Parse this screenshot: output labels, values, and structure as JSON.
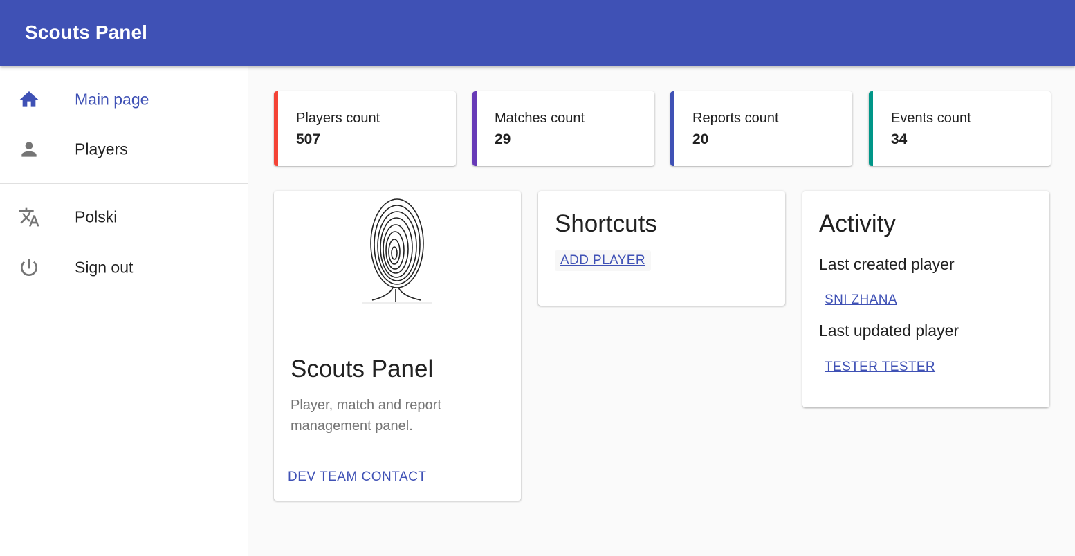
{
  "appbar": {
    "title": "Scouts Panel",
    "color": "#3f51b5"
  },
  "sidebar": {
    "items": [
      {
        "label": "Main page",
        "icon": "home-icon",
        "active": true
      },
      {
        "label": "Players",
        "icon": "person-icon",
        "active": false
      }
    ],
    "secondary": [
      {
        "label": "Polski",
        "icon": "translate-icon"
      },
      {
        "label": "Sign out",
        "icon": "power-icon"
      }
    ]
  },
  "stats": [
    {
      "label": "Players count",
      "value": "507",
      "color": "#f44336"
    },
    {
      "label": "Matches count",
      "value": "29",
      "color": "#673ab7"
    },
    {
      "label": "Reports count",
      "value": "20",
      "color": "#3f51b5"
    },
    {
      "label": "Events count",
      "value": "34",
      "color": "#009688"
    }
  ],
  "about": {
    "image": "fingerprint-image",
    "title": "Scouts Panel",
    "description": "Player, match and report management panel.",
    "action": "DEV TEAM CONTACT"
  },
  "shortcuts": {
    "title": "Shortcuts",
    "add_player": "ADD PLAYER"
  },
  "activity": {
    "title": "Activity",
    "last_created_label": "Last created player",
    "last_created_value": "SNI ZHANA",
    "last_updated_label": "Last updated player",
    "last_updated_value": "TESTER TESTER"
  }
}
